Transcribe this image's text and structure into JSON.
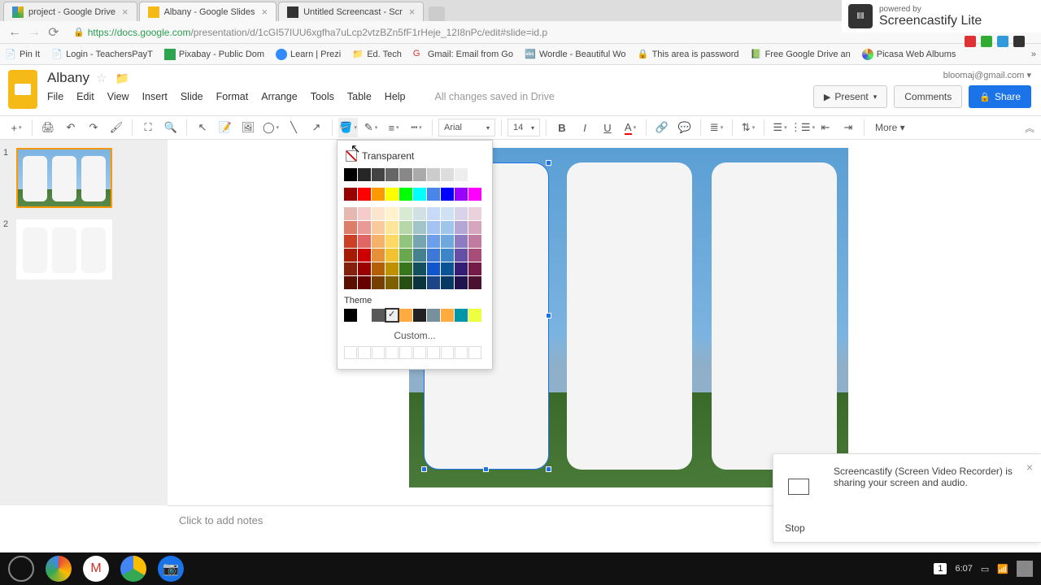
{
  "browser": {
    "tabs": [
      {
        "title": "project - Google Drive",
        "active": false
      },
      {
        "title": "Albany - Google Slides",
        "active": true
      },
      {
        "title": "Untitled Screencast - Scr",
        "active": false
      }
    ],
    "url_host": "https://docs.google.com",
    "url_path": "/presentation/d/1cGI57IUU6xgfha7uLcp2vtzBZn5fF1rHeje_12I8nPc/edit#slide=id.p",
    "bookmarks": [
      "Pin It",
      "Login - TeachersPayT",
      "Pixabay - Public Dom",
      "Learn | Prezi",
      "Ed. Tech",
      "Gmail: Email from Go",
      "Wordle - Beautiful Wo",
      "This area is password",
      "Free Google Drive an",
      "Picasa Web Albums"
    ]
  },
  "app": {
    "title": "Albany",
    "menus": [
      "File",
      "Edit",
      "View",
      "Insert",
      "Slide",
      "Format",
      "Arrange",
      "Tools",
      "Table",
      "Help"
    ],
    "save_status": "All changes saved in Drive",
    "user": "bloomaj@gmail.com",
    "present": "Present",
    "comments": "Comments",
    "share": "Share"
  },
  "toolbar": {
    "font": "Arial",
    "size": "14",
    "more": "More"
  },
  "picker": {
    "transparent": "Transparent",
    "theme_label": "Theme",
    "custom_label": "Custom...",
    "gray_row": [
      "#000000",
      "#262626",
      "#434343",
      "#666666",
      "#888888",
      "#aaaaaa",
      "#cccccc",
      "#dddddd",
      "#eeeeee",
      "#ffffff"
    ],
    "main_row": [
      "#980000",
      "#ff0000",
      "#ff9900",
      "#ffff00",
      "#00ff00",
      "#00ffff",
      "#4a86e8",
      "#0000ff",
      "#9900ff",
      "#ff00ff"
    ],
    "shades": [
      [
        "#e6b8af",
        "#f4cccc",
        "#fce5cd",
        "#fff2cc",
        "#d9ead3",
        "#d0e0e3",
        "#c9daf8",
        "#cfe2f3",
        "#d9d2e9",
        "#ead1dc"
      ],
      [
        "#dd7e6b",
        "#ea9999",
        "#f9cb9c",
        "#ffe599",
        "#b6d7a8",
        "#a2c4c9",
        "#a4c2f4",
        "#9fc5e8",
        "#b4a7d6",
        "#d5a6bd"
      ],
      [
        "#cc4125",
        "#e06666",
        "#f6b26b",
        "#ffd966",
        "#93c47d",
        "#76a5af",
        "#6d9eeb",
        "#6fa8dc",
        "#8e7cc3",
        "#c27ba0"
      ],
      [
        "#a61c00",
        "#cc0000",
        "#e69138",
        "#f1c232",
        "#6aa84f",
        "#45818e",
        "#3c78d8",
        "#3d85c6",
        "#674ea7",
        "#a64d79"
      ],
      [
        "#85200c",
        "#990000",
        "#b45f06",
        "#bf9000",
        "#38761d",
        "#134f5c",
        "#1155cc",
        "#0b5394",
        "#351c75",
        "#741b47"
      ],
      [
        "#5b0f00",
        "#660000",
        "#783f04",
        "#7f6000",
        "#274e13",
        "#0c343d",
        "#1c4587",
        "#073763",
        "#20124d",
        "#4c1130"
      ]
    ],
    "theme_row": [
      "#000000",
      "#ffffff",
      "#595959",
      "#eeeeee",
      "#ffab40",
      "#212121",
      "#78909c",
      "#ffab40",
      "#0097a7",
      "#eeff41"
    ],
    "theme_selected_index": 3
  },
  "filmstrip": {
    "slides": [
      {
        "num": "1",
        "selected": true,
        "has_bg": true
      },
      {
        "num": "2",
        "selected": false,
        "has_bg": false
      }
    ]
  },
  "notes": {
    "placeholder": "Click to add notes"
  },
  "screencastify": {
    "powered": "powered by",
    "name": "Screencastify Lite",
    "notif": "Screencastify (Screen Video Recorder) is sharing your screen and audio.",
    "stop": "Stop"
  },
  "taskbar": {
    "count": "1",
    "time": "6:07"
  }
}
